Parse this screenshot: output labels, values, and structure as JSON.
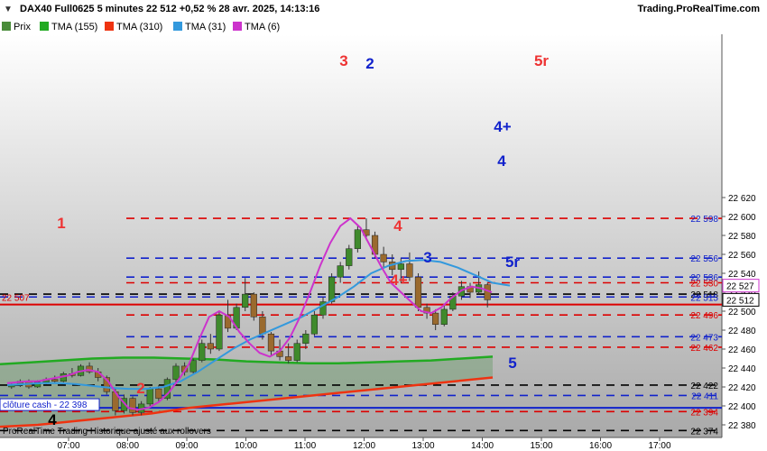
{
  "header": {
    "title": "DAX40 Full0625 5 minutes 22 512 +0,52 % 28 avr. 2025, 14:13:16",
    "brand": "Trading.ProRealTime.com"
  },
  "legend": [
    {
      "label": "Prix",
      "color": "#4a8c3a"
    },
    {
      "label": "TMA (155)",
      "color": "#22aa22"
    },
    {
      "label": "TMA (310)",
      "color": "#ee3311"
    },
    {
      "label": "TMA (31)",
      "color": "#3399dd"
    },
    {
      "label": "TMA (6)",
      "color": "#cc33cc"
    }
  ],
  "footer_note": "ProRealTime Trading  Historique ajusté aux rollovers",
  "cash_close_label": "clôture cash -  22 398",
  "chart_data": {
    "type": "candlestick",
    "ylim": [
      22370,
      22620
    ],
    "yticks": [
      22380,
      22400,
      22420,
      22440,
      22460,
      22480,
      22500,
      22520,
      22540,
      22560,
      22580,
      22600,
      22620
    ],
    "xticks": [
      "07:00",
      "08:00",
      "09:00",
      "10:00",
      "11:00",
      "12:00",
      "13:00",
      "14:00",
      "15:00",
      "16:00",
      "17:00"
    ],
    "current_price": 22512,
    "level_lines": [
      {
        "price": 22598,
        "color": "#dd0000",
        "style": "dashed",
        "tag": "22 598",
        "tag_color": "#1122cc"
      },
      {
        "price": 22556,
        "color": "#1122cc",
        "style": "dashed",
        "tag": "22 556",
        "tag_color": "#1122cc"
      },
      {
        "price": 22536,
        "color": "#1122cc",
        "style": "dashed",
        "tag": "22 536",
        "tag_color": "#1122cc"
      },
      {
        "price": 22530,
        "color": "#dd0000",
        "style": "dashed",
        "tag": "22 530",
        "tag_color": "#dd0000"
      },
      {
        "price": 22518,
        "color": "#000000",
        "style": "dashed",
        "tag": "22 518",
        "tag_color": "#000000"
      },
      {
        "price": 22515,
        "color": "#1122cc",
        "style": "dashed",
        "tag": "22 515",
        "tag_color": "#1122cc"
      },
      {
        "price": 22507,
        "color": "#dd0000",
        "style": "solid",
        "tag": "",
        "tag_color": "#dd0000"
      },
      {
        "price": 22496,
        "color": "#dd0000",
        "style": "dashed",
        "tag": "22 496",
        "tag_color": "#dd0000"
      },
      {
        "price": 22473,
        "color": "#1122cc",
        "style": "dashed",
        "tag": "22 473",
        "tag_color": "#1122cc"
      },
      {
        "price": 22462,
        "color": "#dd0000",
        "style": "dashed",
        "tag": "22 462",
        "tag_color": "#dd0000"
      },
      {
        "price": 22422,
        "color": "#000000",
        "style": "dashed",
        "tag": "22 422",
        "tag_color": "#000000"
      },
      {
        "price": 22411,
        "color": "#1122cc",
        "style": "dashed",
        "tag": "22 411",
        "tag_color": "#1122cc"
      },
      {
        "price": 22398,
        "color": "#1122cc",
        "style": "solid",
        "tag": "",
        "tag_color": "#1122cc"
      },
      {
        "price": 22394,
        "color": "#dd0000",
        "style": "dashed",
        "tag": "22 394",
        "tag_color": "#dd0000"
      },
      {
        "price": 22374,
        "color": "#000000",
        "style": "dashed",
        "tag": "22 374",
        "tag_color": "#000000"
      }
    ],
    "axis_boxes": [
      {
        "price": 22527,
        "text": "22 527",
        "color": "#cc33cc"
      },
      {
        "price": 22512,
        "text": "22 512",
        "color": "#000000"
      }
    ],
    "left_tag": {
      "price": 22507,
      "text": "22 507",
      "color": "#dd0000"
    },
    "annotations": [
      {
        "text": "1",
        "price": 22504,
        "time": "06:57",
        "color": "#ee3333"
      },
      {
        "text": "2",
        "price": 22396,
        "time": "08:14",
        "color": "#ee3333"
      },
      {
        "text": "3",
        "price": 22599,
        "time": "11:42",
        "color": "#ee3333"
      },
      {
        "text": "2",
        "price": 22598,
        "time": "12:00",
        "color": "#1122cc"
      },
      {
        "text": "4",
        "price": 22500,
        "time": "12:36",
        "color": "#ee3333"
      },
      {
        "text": "4+",
        "price": 22464,
        "time": "12:40",
        "color": "#ee3333"
      },
      {
        "text": "3",
        "price": 22476,
        "time": "13:03",
        "color": "#1122cc"
      },
      {
        "text": "4+",
        "price": 22558,
        "time": "13:80",
        "color": "#1122cc"
      },
      {
        "text": "4",
        "price": 22538,
        "time": "14:20",
        "color": "#1122cc"
      },
      {
        "text": "5r",
        "price": 22475,
        "time": "14:30",
        "color": "#1122cc"
      },
      {
        "text": "5r",
        "price": 22598,
        "time": "14:60",
        "color": "#ee3333"
      },
      {
        "text": "5",
        "price": 22410,
        "time": "14:30",
        "color": "#1122cc"
      },
      {
        "text": "4",
        "price": 22374,
        "time": "06:00",
        "color": "#000000"
      }
    ],
    "candles": [
      [
        22420,
        22425,
        22418,
        22422
      ],
      [
        22422,
        22428,
        22420,
        22426
      ],
      [
        22426,
        22428,
        22418,
        22420
      ],
      [
        22420,
        22427,
        22419,
        22425
      ],
      [
        22425,
        22430,
        22423,
        22428
      ],
      [
        22428,
        22432,
        22424,
        22426
      ],
      [
        22426,
        22436,
        22425,
        22434
      ],
      [
        22434,
        22440,
        22430,
        22432
      ],
      [
        22432,
        22444,
        22431,
        22442
      ],
      [
        22442,
        22446,
        22434,
        22436
      ],
      [
        22436,
        22440,
        22426,
        22430
      ],
      [
        22430,
        22432,
        22412,
        22415
      ],
      [
        22415,
        22418,
        22390,
        22395
      ],
      [
        22395,
        22412,
        22392,
        22408
      ],
      [
        22408,
        22410,
        22390,
        22393
      ],
      [
        22393,
        22405,
        22390,
        22402
      ],
      [
        22402,
        22420,
        22398,
        22418
      ],
      [
        22418,
        22422,
        22405,
        22408
      ],
      [
        22408,
        22430,
        22406,
        22428
      ],
      [
        22428,
        22445,
        22425,
        22442
      ],
      [
        22442,
        22446,
        22432,
        22436
      ],
      [
        22436,
        22450,
        22434,
        22448
      ],
      [
        22448,
        22470,
        22446,
        22466
      ],
      [
        22466,
        22476,
        22455,
        22460
      ],
      [
        22460,
        22500,
        22458,
        22496
      ],
      [
        22496,
        22512,
        22478,
        22482
      ],
      [
        22482,
        22508,
        22480,
        22504
      ],
      [
        22504,
        22535,
        22500,
        22518
      ],
      [
        22518,
        22520,
        22490,
        22494
      ],
      [
        22494,
        22500,
        22470,
        22476
      ],
      [
        22476,
        22478,
        22452,
        22458
      ],
      [
        22458,
        22470,
        22448,
        22452
      ],
      [
        22452,
        22466,
        22445,
        22448
      ],
      [
        22448,
        22470,
        22446,
        22466
      ],
      [
        22466,
        22480,
        22460,
        22476
      ],
      [
        22476,
        22500,
        22474,
        22496
      ],
      [
        22496,
        22515,
        22492,
        22510
      ],
      [
        22510,
        22540,
        22508,
        22536
      ],
      [
        22536,
        22552,
        22530,
        22548
      ],
      [
        22548,
        22570,
        22544,
        22566
      ],
      [
        22566,
        22590,
        22562,
        22586
      ],
      [
        22586,
        22598,
        22575,
        22580
      ],
      [
        22580,
        22584,
        22556,
        22560
      ],
      [
        22560,
        22568,
        22546,
        22552
      ],
      [
        22552,
        22560,
        22538,
        22544
      ],
      [
        22544,
        22556,
        22530,
        22550
      ],
      [
        22550,
        22562,
        22532,
        22536
      ],
      [
        22536,
        22540,
        22500,
        22504
      ],
      [
        22504,
        22508,
        22492,
        22498
      ],
      [
        22498,
        22502,
        22480,
        22486
      ],
      [
        22486,
        22506,
        22484,
        22502
      ],
      [
        22502,
        22520,
        22500,
        22516
      ],
      [
        22516,
        22532,
        22512,
        22526
      ],
      [
        22526,
        22530,
        22514,
        22520
      ],
      [
        22520,
        22542,
        22518,
        22528
      ],
      [
        22528,
        22530,
        22504,
        22512
      ]
    ],
    "tma6": [
      22424,
      22425,
      22426,
      22426,
      22428,
      22430,
      22432,
      22436,
      22438,
      22436,
      22426,
      22410,
      22398,
      22396,
      22398,
      22404,
      22414,
      22428,
      22444,
      22470,
      22494,
      22500,
      22494,
      22478,
      22466,
      22456,
      22452,
      22458,
      22472,
      22494,
      22520,
      22548,
      22572,
      22590,
      22598,
      22588,
      22568,
      22548,
      22530,
      22520,
      22510,
      22500,
      22498,
      22504,
      22514,
      22522,
      22526,
      22524,
      22520
    ],
    "tma31": [
      22422,
      22423,
      22424,
      22424,
      22423,
      22421,
      22419,
      22418,
      22418,
      22420,
      22426,
      22436,
      22448,
      22460,
      22470,
      22478,
      22486,
      22494,
      22504,
      22514,
      22526,
      22540,
      22548,
      22553,
      22554,
      22552,
      22546,
      22538,
      22530,
      22527
    ],
    "tma155": [
      22444,
      22446,
      22448,
      22450,
      22451,
      22451,
      22450,
      22449,
      22447,
      22446,
      22445,
      22445,
      22446,
      22447,
      22448,
      22450,
      22452
    ],
    "tma310": [
      22378,
      22380,
      22384,
      22388,
      22392,
      22398,
      22402,
      22406,
      22410,
      22414,
      22418,
      22422,
      22426,
      22430
    ]
  }
}
